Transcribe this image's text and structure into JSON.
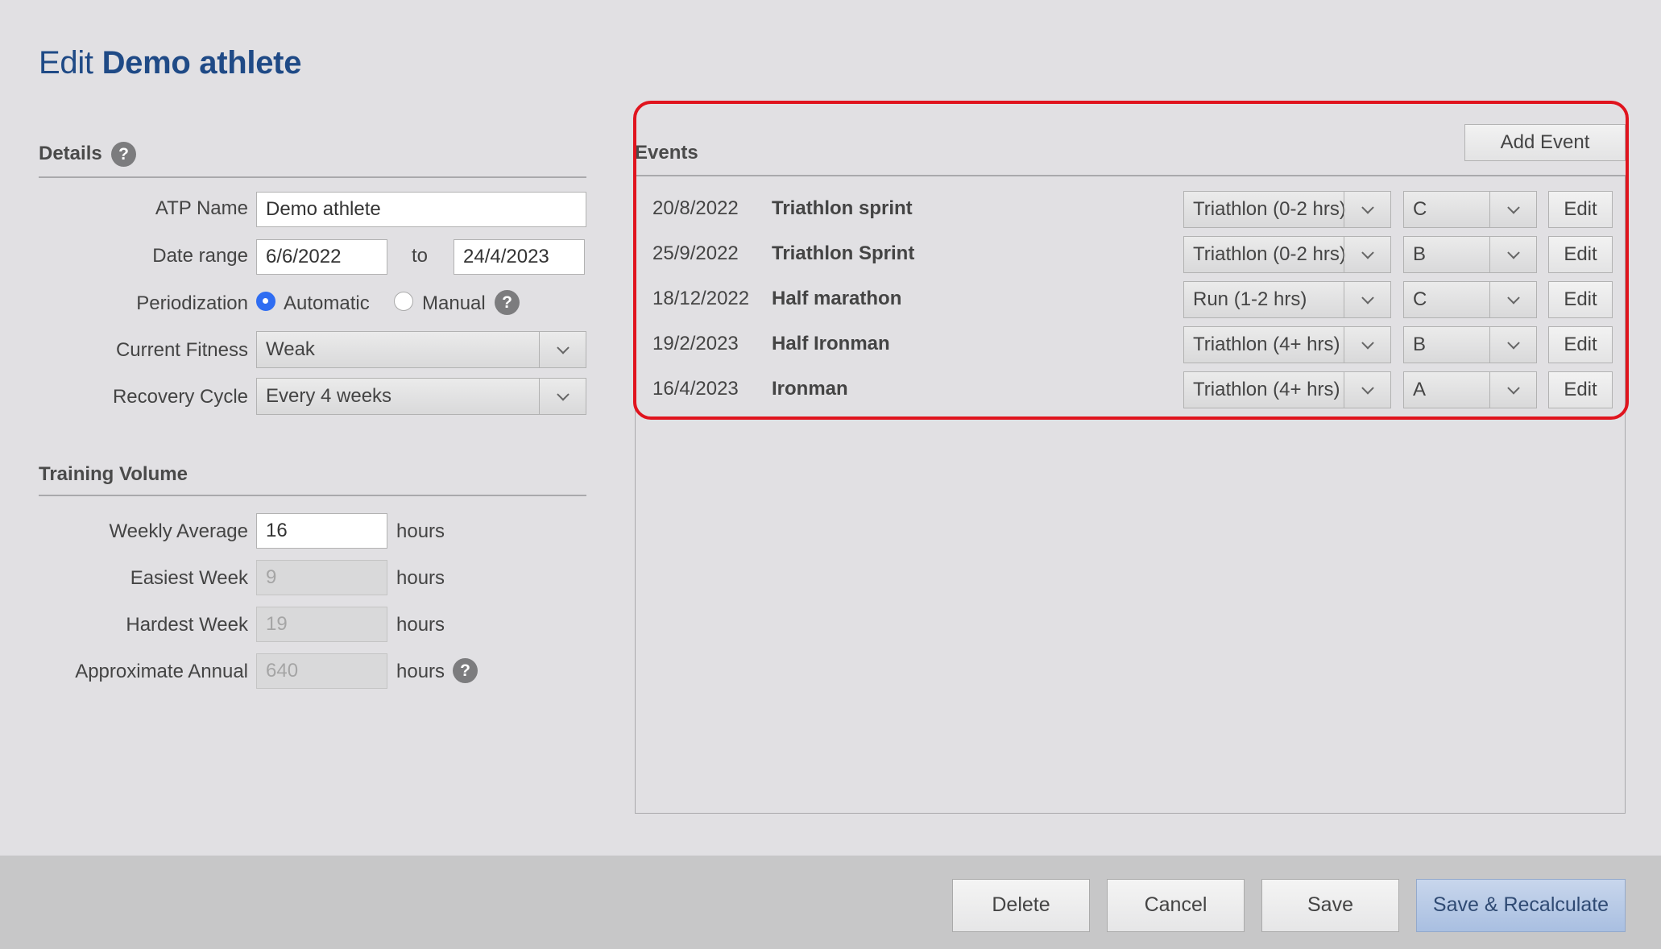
{
  "title": {
    "prefix": "Edit",
    "athlete": "Demo athlete"
  },
  "details": {
    "heading": "Details",
    "atp_name_label": "ATP Name",
    "atp_name_value": "Demo athlete",
    "date_range_label": "Date range",
    "date_from": "6/6/2022",
    "date_to_sep": "to",
    "date_to": "24/4/2023",
    "periodization_label": "Periodization",
    "periodization_options": [
      "Automatic",
      "Manual"
    ],
    "periodization_selected": "Automatic",
    "fitness_label": "Current Fitness",
    "fitness_value": "Weak",
    "recovery_label": "Recovery Cycle",
    "recovery_value": "Every 4 weeks"
  },
  "training": {
    "heading": "Training Volume",
    "weekly_label": "Weekly Average",
    "weekly_value": "16",
    "easiest_label": "Easiest Week",
    "easiest_value": "9",
    "hardest_label": "Hardest Week",
    "hardest_value": "19",
    "annual_label": "Approximate Annual",
    "annual_value": "640",
    "unit": "hours"
  },
  "events": {
    "heading": "Events",
    "add_label": "Add Event",
    "edit_label": "Edit",
    "rows": [
      {
        "date": "20/8/2022",
        "name": "Triathlon sprint",
        "type": "Triathlon (0-2 hrs)",
        "priority": "C"
      },
      {
        "date": "25/9/2022",
        "name": "Triathlon Sprint",
        "type": "Triathlon (0-2 hrs)",
        "priority": "B"
      },
      {
        "date": "18/12/2022",
        "name": "Half marathon",
        "type": "Run (1-2 hrs)",
        "priority": "C"
      },
      {
        "date": "19/2/2023",
        "name": "Half Ironman",
        "type": "Triathlon (4+ hrs)",
        "priority": "B"
      },
      {
        "date": "16/4/2023",
        "name": "Ironman",
        "type": "Triathlon (4+ hrs)",
        "priority": "A"
      }
    ]
  },
  "footer": {
    "delete": "Delete",
    "cancel": "Cancel",
    "save": "Save",
    "save_recalc": "Save & Recalculate"
  },
  "help_glyph": "?",
  "colors": {
    "title": "#1f4a86",
    "highlight": "#e0141e",
    "radio_checked": "#2f6df2",
    "primary_button": "#b4c6e4"
  }
}
